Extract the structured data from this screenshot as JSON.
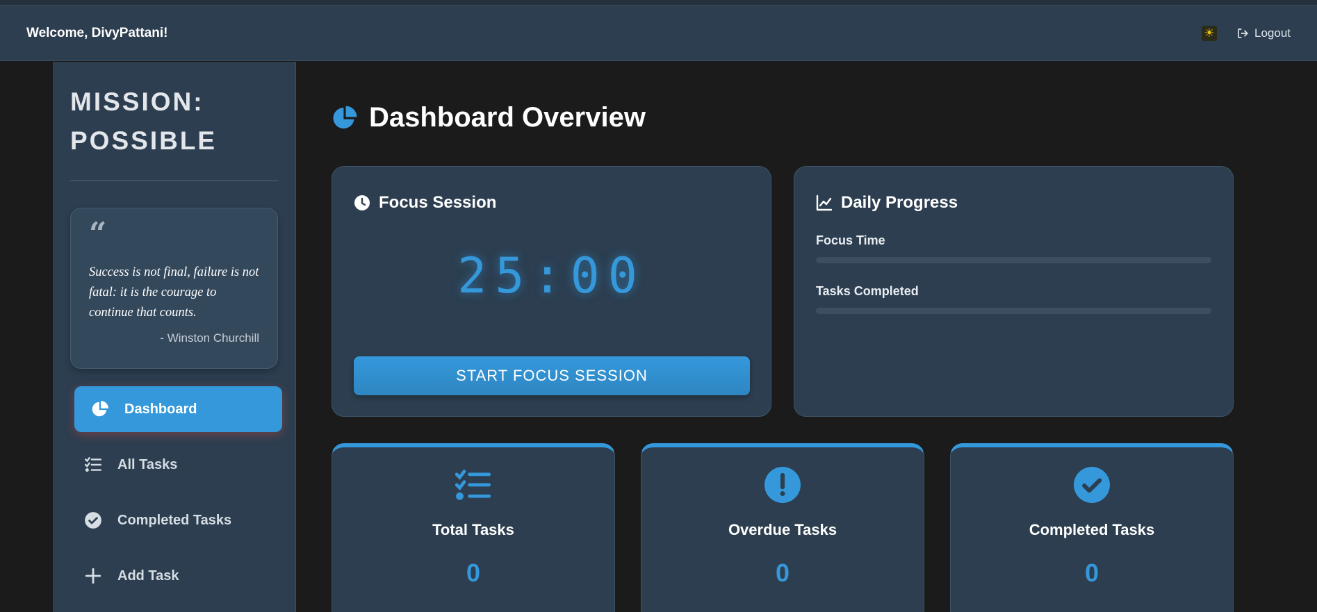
{
  "header": {
    "welcome": "Welcome, DivyPattani!",
    "theme_icon": "sun-icon",
    "logout_label": "Logout"
  },
  "sidebar": {
    "brand_line1": "MISSION:",
    "brand_line2": "POSSIBLE",
    "quote": {
      "text": "Success is not final, failure is not fatal: it is the courage to continue that counts.",
      "author": "- Winston Churchill"
    },
    "items": [
      {
        "label": "Dashboard",
        "icon": "pie-chart-icon",
        "active": true
      },
      {
        "label": "All Tasks",
        "icon": "task-list-icon",
        "active": false
      },
      {
        "label": "Completed Tasks",
        "icon": "check-circle-icon",
        "active": false
      },
      {
        "label": "Add Task",
        "icon": "plus-icon",
        "active": false
      }
    ]
  },
  "main": {
    "title": "Dashboard Overview",
    "focus": {
      "title": "Focus Session",
      "timer": "25:00",
      "button": "START FOCUS SESSION"
    },
    "progress": {
      "title": "Daily Progress",
      "focus_label": "Focus Time",
      "focus_value": 0,
      "tasks_label": "Tasks Completed",
      "tasks_value": 0
    },
    "stats": [
      {
        "label": "Total Tasks",
        "value": "0",
        "icon": "task-list-icon"
      },
      {
        "label": "Overdue Tasks",
        "value": "0",
        "icon": "exclamation-circle-icon"
      },
      {
        "label": "Completed Tasks",
        "value": "0",
        "icon": "check-circle-icon"
      }
    ]
  },
  "colors": {
    "accent": "#3498db",
    "panel": "#2c3e50",
    "background": "#1b1b1b"
  }
}
